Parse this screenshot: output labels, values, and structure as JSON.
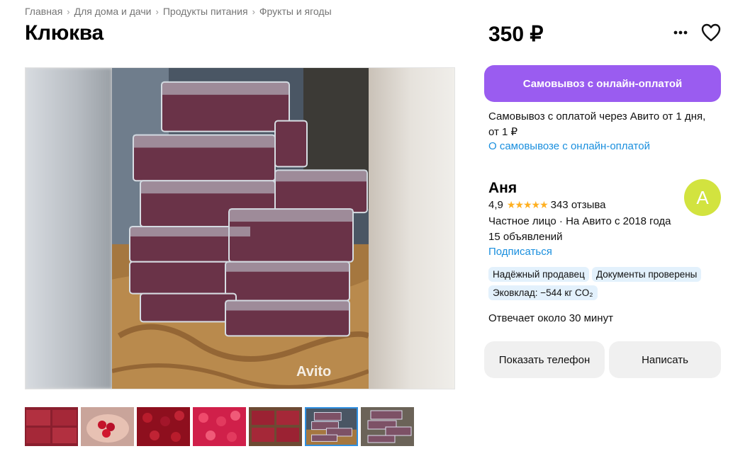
{
  "breadcrumbs": [
    "Главная",
    "Для дома и дачи",
    "Продукты питания",
    "Фрукты и ягоды"
  ],
  "breadcrumb_separator": "›",
  "title": "Клюква",
  "price": "350 ₽",
  "icons": {
    "more": "more-dots-icon",
    "favorite": "heart-icon"
  },
  "gallery": {
    "watermark": "Avito",
    "thumbnail_count": 7,
    "active_thumbnail": 6
  },
  "pickup": {
    "button_label": "Самовывоз с онлайн-оплатой",
    "description": "Самовывоз с оплатой через Авито от 1 дня, от 1 ₽",
    "link": "О самовывозе с онлайн-оплатой"
  },
  "seller": {
    "name": "Аня",
    "avatar_letter": "А",
    "rating": "4,9",
    "stars": "★★★★★",
    "reviews": "343 отзыва",
    "type": "Частное лицо · На Авито с 2018 года",
    "listings": "15 объявлений",
    "subscribe": "Подписаться",
    "badges": [
      "Надёжный продавец",
      "Документы проверены",
      "Эковклад: −544 кг CO₂"
    ],
    "response_time": "Отвечает около 30 минут"
  },
  "actions": {
    "phone": "Показать телефон",
    "message": "Написать"
  },
  "colors": {
    "accent": "#9a5cf0",
    "link": "#1a8fde",
    "star": "#ffb021",
    "avatar": "#d2e33f",
    "badge_bg": "#e3f1fc"
  }
}
